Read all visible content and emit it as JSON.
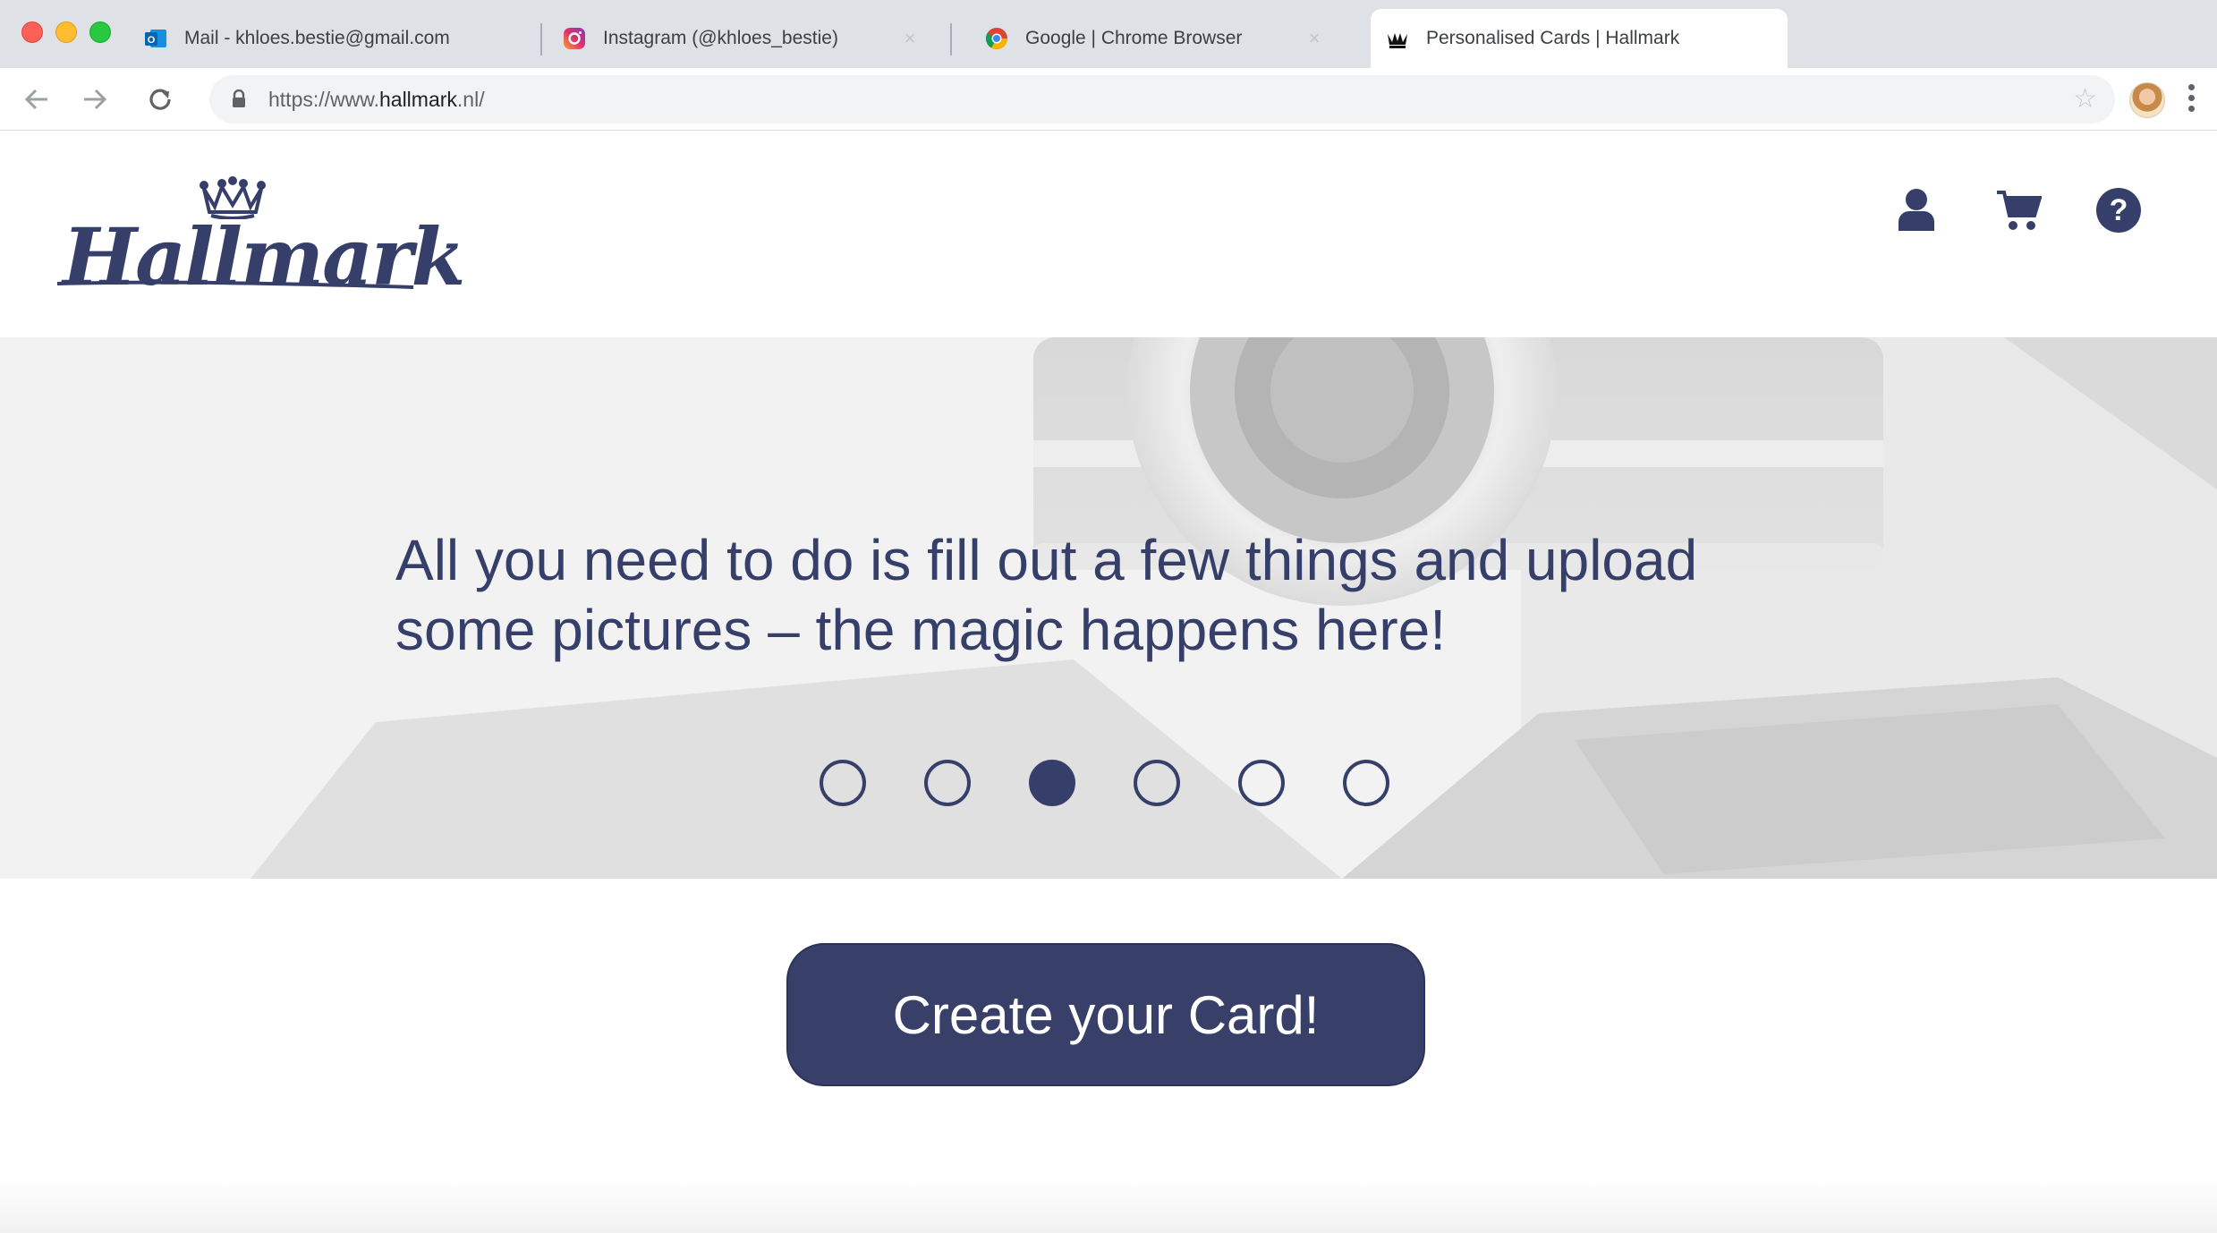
{
  "browser": {
    "tabs": [
      {
        "title": "Mail - khloes.bestie@gmail.com",
        "icon": "outlook-icon"
      },
      {
        "title": "Instagram (@khloes_bestie)",
        "icon": "instagram-icon"
      },
      {
        "title": "Google | Chrome Browser",
        "icon": "chrome-icon"
      },
      {
        "title": "Personalised Cards | Hallmark",
        "icon": "hallmark-crown-icon",
        "active": true
      }
    ],
    "url": {
      "prefix": "https://www.",
      "host": "hallmark",
      "suffix": ".nl/"
    }
  },
  "site": {
    "logo_text": "Hallmark",
    "header_icons": [
      "account-icon",
      "cart-icon",
      "help-icon"
    ]
  },
  "hero": {
    "headline_line1": "All you need to do is fill out a few things and upload",
    "headline_line2": "some pictures – the magic happens here!",
    "carousel": {
      "slide_count": 6,
      "active_index": 2
    }
  },
  "cta": {
    "label": "Create your Card!"
  },
  "colors": {
    "brand_navy": "#353f6a",
    "cta_bg": "#383f69"
  }
}
